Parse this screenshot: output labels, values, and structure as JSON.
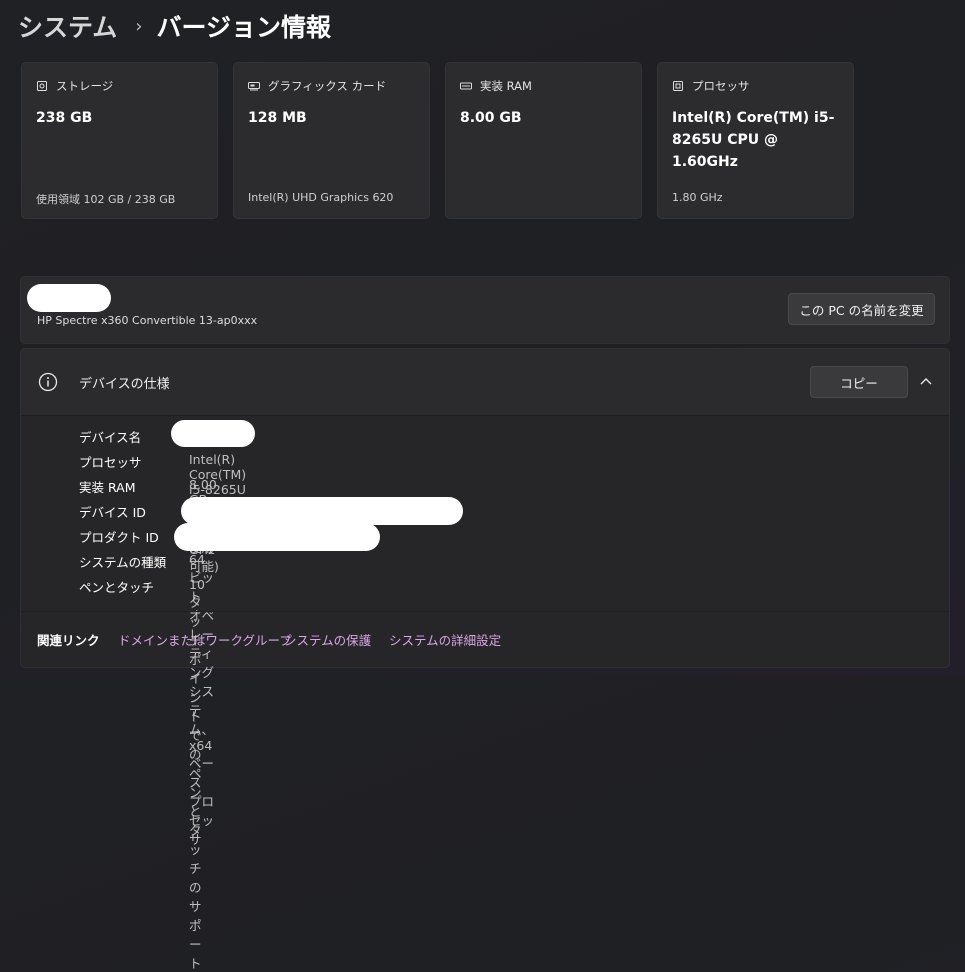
{
  "breadcrumb": {
    "parent": "システム",
    "separator": "›",
    "current": "バージョン情報"
  },
  "cards": [
    {
      "label": "ストレージ",
      "value": "238 GB",
      "sub": "使用領域 102 GB / 238 GB",
      "icon": "storage-icon"
    },
    {
      "label": "グラフィックス カード",
      "value": "128 MB",
      "sub": "Intel(R) UHD Graphics 620",
      "icon": "graphics-card-icon"
    },
    {
      "label": "実装 RAM",
      "value": "8.00 GB",
      "sub": "",
      "icon": "ram-icon"
    },
    {
      "label": "プロセッサ",
      "value": "Intel(R) Core(TM) i5-8265U CPU @ 1.60GHz",
      "sub": "1.80 GHz",
      "icon": "processor-icon"
    }
  ],
  "pc": {
    "model": "HP Spectre x360 Convertible 13-ap0xxx",
    "rename_label": "この PC の名前を変更"
  },
  "spec": {
    "title": "デバイスの仕様",
    "copy_label": "コピー",
    "rows": [
      {
        "label": "デバイス名",
        "value": ""
      },
      {
        "label": "プロセッサ",
        "value": "Intel(R) Core(TM) i5-8265U CPU @ 1.60GHz   1.80 GHz"
      },
      {
        "label": "実装 RAM",
        "value": "8.00 GB (7.74 GB 使用可能)"
      },
      {
        "label": "デバイス ID",
        "value": ""
      },
      {
        "label": "プロダクト ID",
        "value": ""
      },
      {
        "label": "システムの種類",
        "value": "64 ビット オペレーティング システム、x64 ベース プロセッサ"
      },
      {
        "label": "ペンとタッチ",
        "value": "10 タッチ ポイントでのペンとタッチのサポート"
      }
    ]
  },
  "related": {
    "label": "関連リンク",
    "links": [
      "ドメインまたはワークグループ",
      "システムの保護",
      "システムの詳細設定"
    ]
  },
  "colors": {
    "link_accent": "#d9a6e6",
    "card_bg": "#2c2c2e",
    "background": "#202124"
  }
}
